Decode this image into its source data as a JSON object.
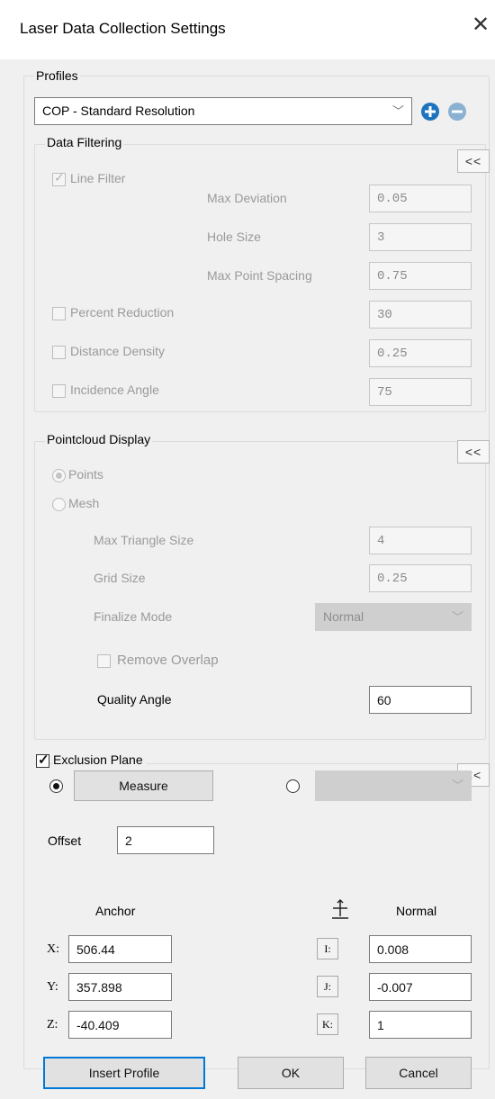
{
  "window": {
    "title": "Laser Data Collection Settings",
    "close_glyph": "✕"
  },
  "profiles": {
    "group_label": "Profiles",
    "selected": "COP - Standard Resolution",
    "add_icon": "plus-circle-icon",
    "remove_icon": "minus-circle-icon",
    "accent": "#1e73be"
  },
  "data_filtering": {
    "label": "Data Filtering",
    "collapse_label": "<<",
    "line_filter": {
      "label": "Line Filter",
      "checked": true
    },
    "max_deviation": {
      "label": "Max Deviation",
      "value": "0.05"
    },
    "hole_size": {
      "label": "Hole Size",
      "value": "3"
    },
    "max_point_spacing": {
      "label": "Max Point Spacing",
      "value": "0.75"
    },
    "percent_reduction": {
      "label": "Percent Reduction",
      "value": "30",
      "checked": false
    },
    "distance_density": {
      "label": "Distance Density",
      "value": "0.25",
      "checked": false
    },
    "incidence_angle": {
      "label": "Incidence Angle",
      "value": "75",
      "checked": false
    }
  },
  "pointcloud_display": {
    "label": "Pointcloud Display",
    "collapse_label": "<<",
    "points_label": "Points",
    "mesh_label": "Mesh",
    "selected": "Points",
    "max_triangle_size": {
      "label": "Max Triangle Size",
      "value": "4"
    },
    "grid_size": {
      "label": "Grid Size",
      "value": "0.25"
    },
    "finalize_mode": {
      "label": "Finalize Mode",
      "value": "Normal"
    },
    "remove_overlap": {
      "label": "Remove Overlap",
      "checked": false
    },
    "quality_angle": {
      "label": "Quality Angle",
      "value": "60"
    }
  },
  "exclusion_plane": {
    "label": "Exclusion Plane",
    "checked": true,
    "collapse_label": "<<",
    "measure_label": "Measure",
    "offset_label": "Offset",
    "offset_value": "2",
    "anchor_label": "Anchor",
    "normal_label": "Normal",
    "normal_icon": "crosshair-arrows-icon",
    "x_label": "X:",
    "x_value": "506.44",
    "y_label": "Y:",
    "y_value": "357.898",
    "z_label": "Z:",
    "z_value": "-40.409",
    "i_label": "I:",
    "i_value": "0.008",
    "j_label": "J:",
    "j_value": "-0.007",
    "k_label": "K:",
    "k_value": "1"
  },
  "footer": {
    "insert_profile": "Insert Profile",
    "ok": "OK",
    "cancel": "Cancel"
  }
}
